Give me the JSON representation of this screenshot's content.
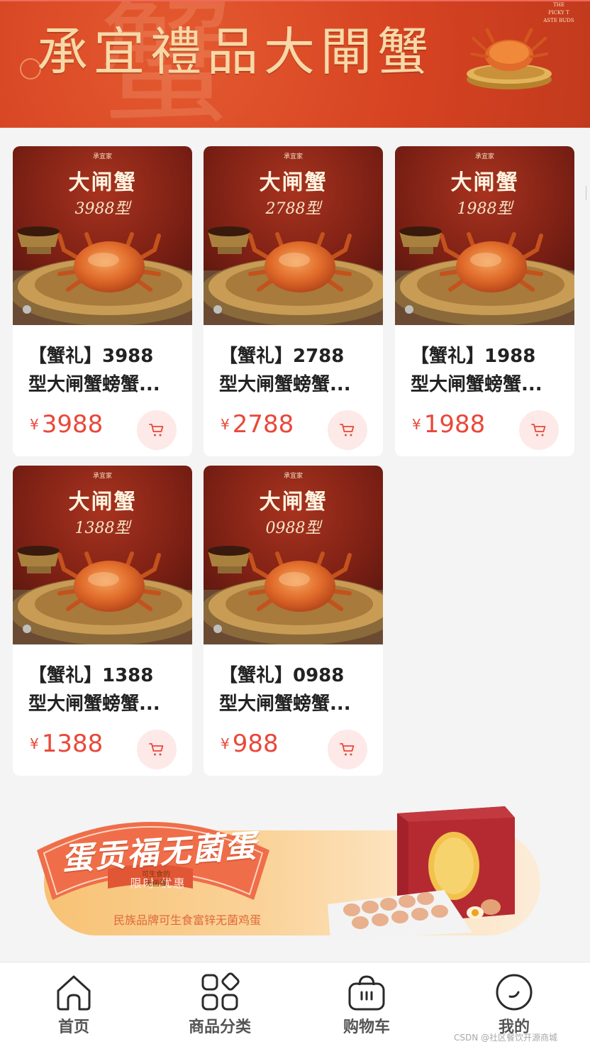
{
  "top_banner": {
    "title": "承宜禮品大閘蟹",
    "ghost_char": "蟹",
    "corner_text": "THE\nPICKY T\nASTE BUDS"
  },
  "products": [
    {
      "img_brand": "承宜家",
      "img_title": "大闸蟹",
      "img_model": "3988型",
      "name_line1": "【蟹礼】3988",
      "name_line2": "型大闸蟹螃蟹...",
      "currency": "¥",
      "price": "3988"
    },
    {
      "img_brand": "承宜家",
      "img_title": "大闸蟹",
      "img_model": "2788型",
      "name_line1": "【蟹礼】2788",
      "name_line2": "型大闸蟹螃蟹...",
      "currency": "¥",
      "price": "2788"
    },
    {
      "img_brand": "承宜家",
      "img_title": "大闸蟹",
      "img_model": "1988型",
      "name_line1": "【蟹礼】1988",
      "name_line2": "型大闸蟹螃蟹...",
      "currency": "¥",
      "price": "1988"
    },
    {
      "img_brand": "承宜家",
      "img_title": "大闸蟹",
      "img_model": "1388型",
      "name_line1": "【蟹礼】1388",
      "name_line2": "型大闸蟹螃蟹...",
      "currency": "¥",
      "price": "1388"
    },
    {
      "img_brand": "承宜家",
      "img_title": "大闸蟹",
      "img_model": "0988型",
      "name_line1": "【蟹礼】0988",
      "name_line2": "型大闸蟹螃蟹...",
      "currency": "¥",
      "price": "988"
    }
  ],
  "promo": {
    "title": "蛋贡福无菌蛋",
    "tag": "限时 优惠",
    "subtitle": "民族品牌可生食富锌无菌鸡蛋",
    "box_text": "可生食的\n无菌蛋"
  },
  "nav": {
    "items": [
      {
        "label": "首页",
        "icon": "home-icon"
      },
      {
        "label": "商品分类",
        "icon": "category-grid-icon"
      },
      {
        "label": "购物车",
        "icon": "shopping-basket-icon"
      },
      {
        "label": "我的",
        "icon": "profile-smile-icon"
      }
    ]
  },
  "watermark": "CSDN @社区餐饮开源商城",
  "colors": {
    "banner_red": "#d64322",
    "price_red": "#e9483a",
    "cart_bg": "#fde9e7",
    "page_bg": "#f4f4f4"
  }
}
